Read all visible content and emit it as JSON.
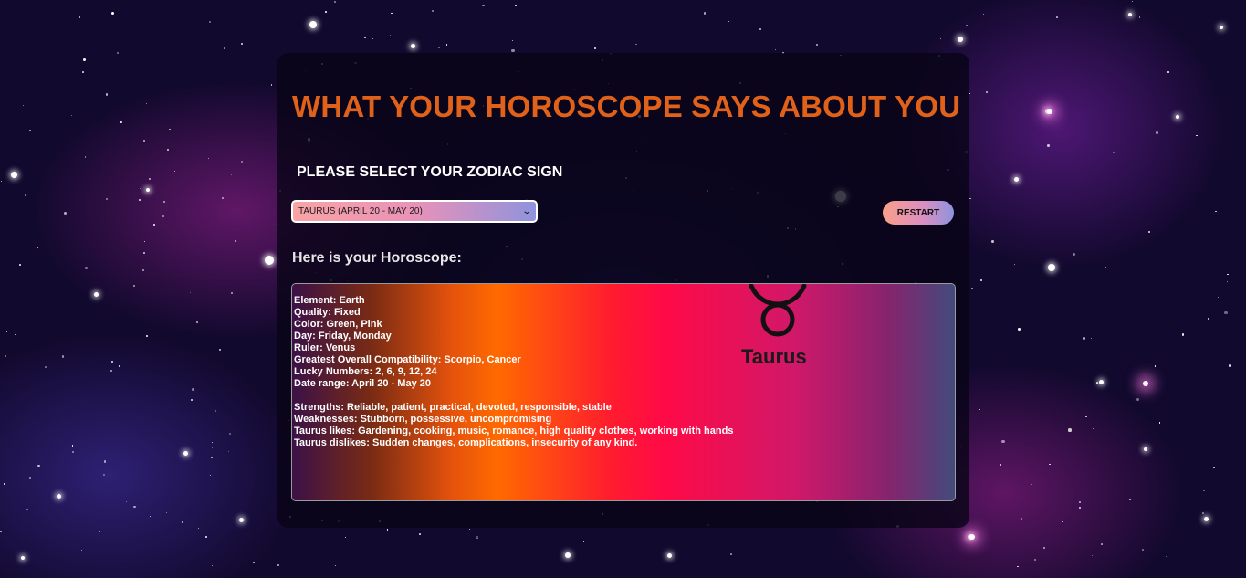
{
  "page": {
    "title": "WHAT YOUR HOROSCOPE SAYS ABOUT YOU",
    "select_label": "PLEASE SELECT YOUR ZODIAC SIGN",
    "selected_sign": "TAURUS (APRIL 20 - MAY 20)",
    "restart_label": "RESTART",
    "result_heading": "Here is your Horoscope:"
  },
  "horoscope": {
    "sign_name": "Taurus",
    "sign_icon": "taurus-symbol-icon",
    "details": [
      "Element: Earth",
      "Quality: Fixed",
      "Color: Green, Pink",
      "Day: Friday, Monday",
      "Ruler: Venus",
      "Greatest Overall Compatibility: Scorpio, Cancer",
      "Lucky Numbers: 2, 6, 9, 12, 24",
      "Date range: April 20 - May 20"
    ],
    "traits": [
      "Strengths: Reliable, patient, practical, devoted, responsible, stable",
      "Weaknesses: Stubborn, possessive, uncompromising",
      "Taurus likes: Gardening, cooking, music, romance, high quality clothes, working with hands",
      "Taurus dislikes: Sudden changes, complications, insecurity of any kind."
    ]
  },
  "colors": {
    "title": "#e0611a",
    "background": "#12092e"
  }
}
